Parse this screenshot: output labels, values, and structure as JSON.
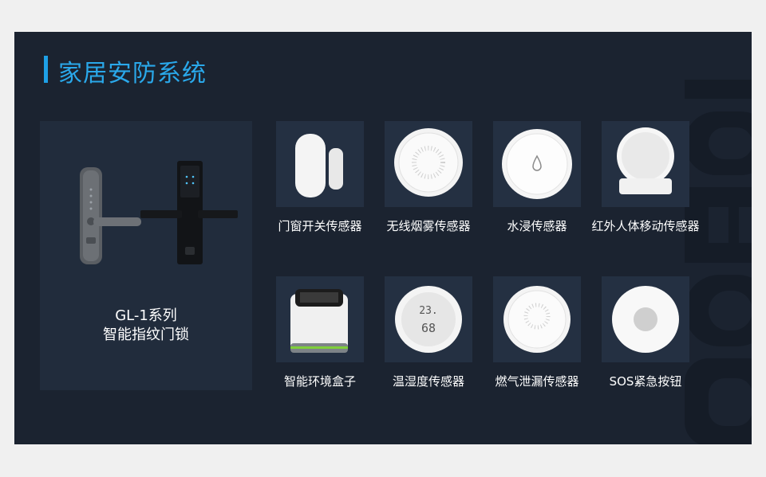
{
  "title": "家居安防系统",
  "colors": {
    "accent": "#1ea0e6",
    "slide_bg": "#1b2330",
    "tile_bg": "#243042"
  },
  "lock": {
    "model": "GL-1系列",
    "name": "智能指纹门锁"
  },
  "products": [
    {
      "label": "门窗开关传感器",
      "icon": "door-window-sensor-icon"
    },
    {
      "label": "无线烟雾传感器",
      "icon": "smoke-sensor-icon"
    },
    {
      "label": "水浸传感器",
      "icon": "water-leak-sensor-icon"
    },
    {
      "label": "红外人体移动传感器",
      "icon": "motion-sensor-icon"
    },
    {
      "label": "智能环境盒子",
      "icon": "environment-box-icon"
    },
    {
      "label": "温湿度传感器",
      "icon": "temperature-humidity-sensor-icon"
    },
    {
      "label": "燃气泄漏传感器",
      "icon": "gas-leak-sensor-icon"
    },
    {
      "label": "SOS紧急按钮",
      "icon": "sos-button-icon"
    }
  ],
  "display": {
    "temperature": "23.",
    "humidity": "68"
  }
}
